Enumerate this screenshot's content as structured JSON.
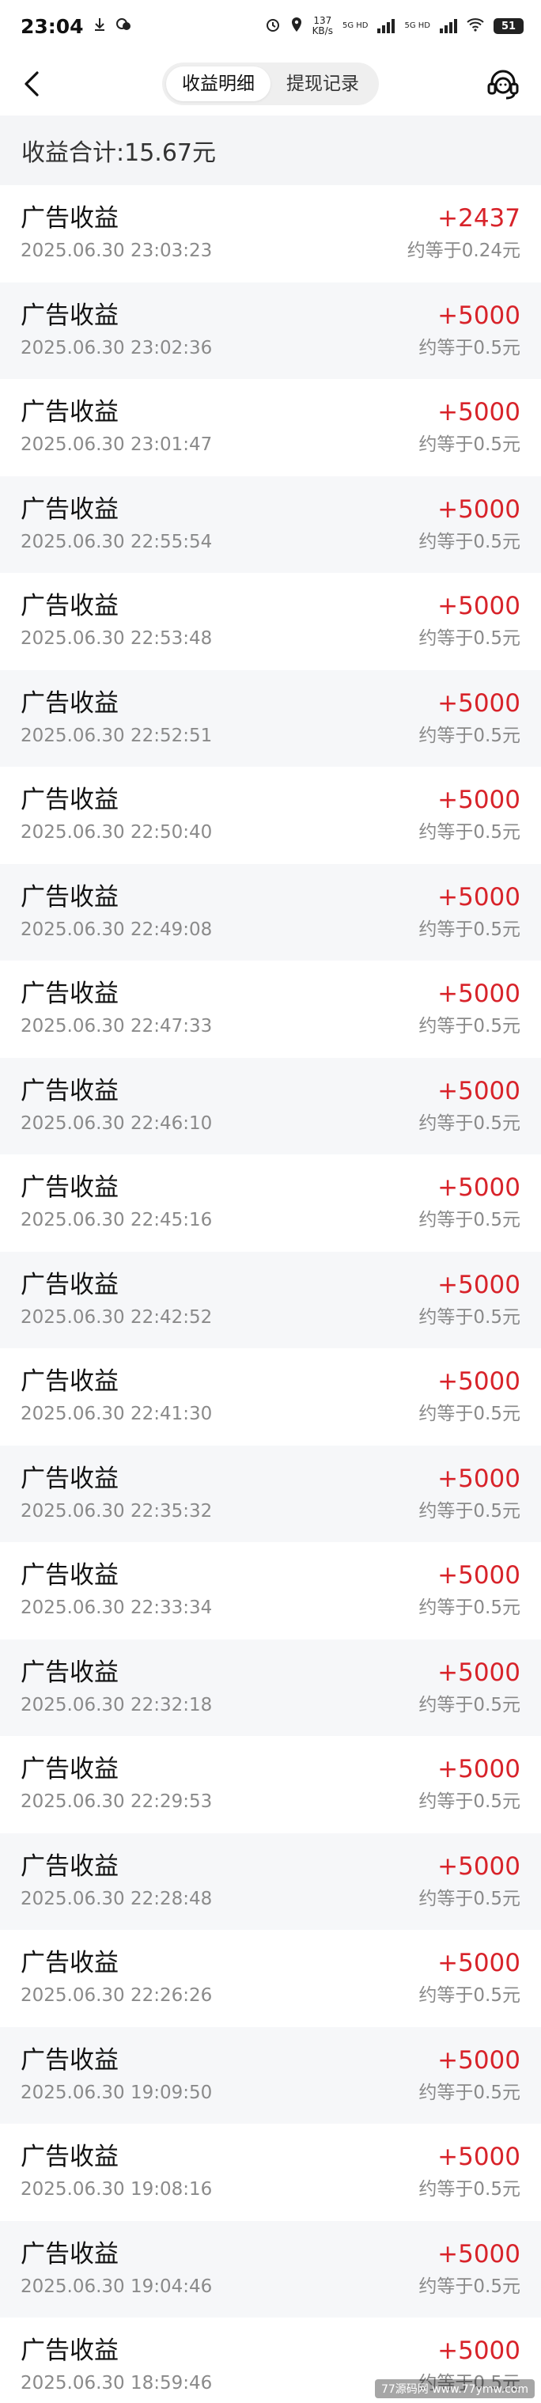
{
  "status_bar": {
    "time": "23:04",
    "net_speed_value": "137",
    "net_speed_unit": "KB/s",
    "sim1_label": "5G HD",
    "sim2_label": "5G HD",
    "battery": "51"
  },
  "nav": {
    "tabs": [
      {
        "label": "收益明细",
        "active": true
      },
      {
        "label": "提现记录",
        "active": false
      }
    ]
  },
  "summary": {
    "label": "收益合计:15.67元"
  },
  "records": [
    {
      "title": "广告收益",
      "time": "2025.06.30 23:03:23",
      "amount": "+2437",
      "approx": "约等于0.24元"
    },
    {
      "title": "广告收益",
      "time": "2025.06.30 23:02:36",
      "amount": "+5000",
      "approx": "约等于0.5元"
    },
    {
      "title": "广告收益",
      "time": "2025.06.30 23:01:47",
      "amount": "+5000",
      "approx": "约等于0.5元"
    },
    {
      "title": "广告收益",
      "time": "2025.06.30 22:55:54",
      "amount": "+5000",
      "approx": "约等于0.5元"
    },
    {
      "title": "广告收益",
      "time": "2025.06.30 22:53:48",
      "amount": "+5000",
      "approx": "约等于0.5元"
    },
    {
      "title": "广告收益",
      "time": "2025.06.30 22:52:51",
      "amount": "+5000",
      "approx": "约等于0.5元"
    },
    {
      "title": "广告收益",
      "time": "2025.06.30 22:50:40",
      "amount": "+5000",
      "approx": "约等于0.5元"
    },
    {
      "title": "广告收益",
      "time": "2025.06.30 22:49:08",
      "amount": "+5000",
      "approx": "约等于0.5元"
    },
    {
      "title": "广告收益",
      "time": "2025.06.30 22:47:33",
      "amount": "+5000",
      "approx": "约等于0.5元"
    },
    {
      "title": "广告收益",
      "time": "2025.06.30 22:46:10",
      "amount": "+5000",
      "approx": "约等于0.5元"
    },
    {
      "title": "广告收益",
      "time": "2025.06.30 22:45:16",
      "amount": "+5000",
      "approx": "约等于0.5元"
    },
    {
      "title": "广告收益",
      "time": "2025.06.30 22:42:52",
      "amount": "+5000",
      "approx": "约等于0.5元"
    },
    {
      "title": "广告收益",
      "time": "2025.06.30 22:41:30",
      "amount": "+5000",
      "approx": "约等于0.5元"
    },
    {
      "title": "广告收益",
      "time": "2025.06.30 22:35:32",
      "amount": "+5000",
      "approx": "约等于0.5元"
    },
    {
      "title": "广告收益",
      "time": "2025.06.30 22:33:34",
      "amount": "+5000",
      "approx": "约等于0.5元"
    },
    {
      "title": "广告收益",
      "time": "2025.06.30 22:32:18",
      "amount": "+5000",
      "approx": "约等于0.5元"
    },
    {
      "title": "广告收益",
      "time": "2025.06.30 22:29:53",
      "amount": "+5000",
      "approx": "约等于0.5元"
    },
    {
      "title": "广告收益",
      "time": "2025.06.30 22:28:48",
      "amount": "+5000",
      "approx": "约等于0.5元"
    },
    {
      "title": "广告收益",
      "time": "2025.06.30 22:26:26",
      "amount": "+5000",
      "approx": "约等于0.5元"
    },
    {
      "title": "广告收益",
      "time": "2025.06.30 19:09:50",
      "amount": "+5000",
      "approx": "约等于0.5元"
    },
    {
      "title": "广告收益",
      "time": "2025.06.30 19:08:16",
      "amount": "+5000",
      "approx": "约等于0.5元"
    },
    {
      "title": "广告收益",
      "time": "2025.06.30 19:04:46",
      "amount": "+5000",
      "approx": "约等于0.5元"
    },
    {
      "title": "广告收益",
      "time": "2025.06.30 18:59:46",
      "amount": "+5000",
      "approx": "约等于0.5元"
    }
  ],
  "watermark": "77源码网 www.77ymw.com",
  "colors": {
    "amount": "#d8232a",
    "secondary_text": "#8a8a8a",
    "row_alt_bg": "#f6f7f9"
  }
}
